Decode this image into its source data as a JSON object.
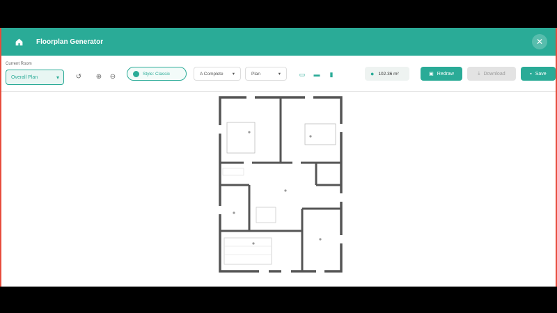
{
  "header": {
    "title": "Floorplan Generator"
  },
  "toolbar": {
    "room_label": "Current Room",
    "room_value": "Overall Plan",
    "style_label": "Style: Classic",
    "dropdown1": "A Complete",
    "dropdown2": "Plan",
    "area": "102.36 m²",
    "redraw": "Redraw",
    "download": "Download",
    "save": "Save"
  },
  "colors": {
    "accent": "#2aab97",
    "wall": "#555555"
  }
}
